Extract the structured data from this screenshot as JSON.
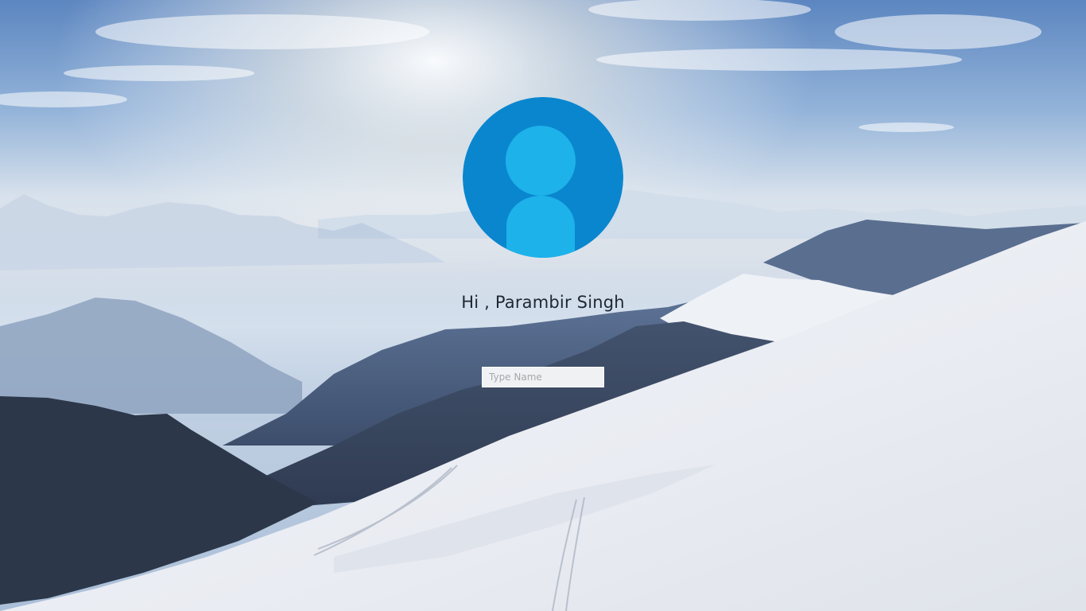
{
  "greeting": {
    "text": "Hi , Parambir Singh"
  },
  "name_input": {
    "value": "",
    "placeholder": "Type Name"
  },
  "avatar": {
    "icon": "user-silhouette-icon",
    "ring_color": "#0a86cf",
    "figure_color": "#1db2ea"
  }
}
